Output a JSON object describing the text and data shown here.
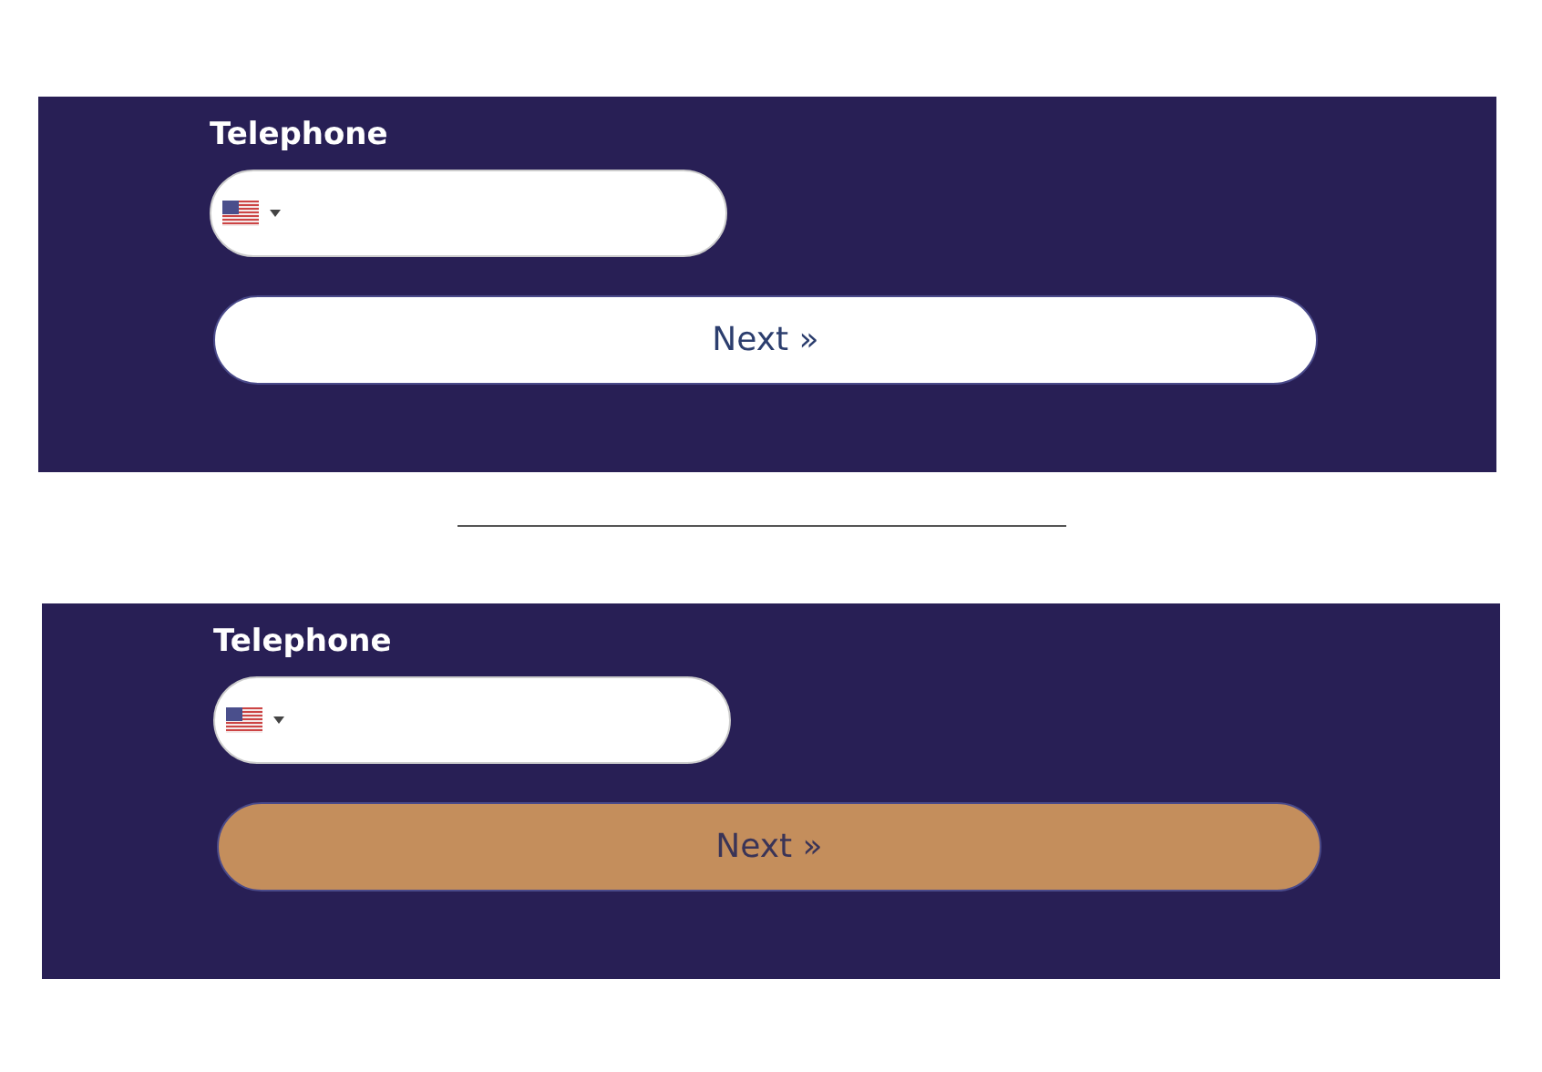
{
  "forms": [
    {
      "label": "Telephone",
      "button": {
        "label": "Next »",
        "hovered": false
      }
    },
    {
      "label": "Telephone",
      "button": {
        "label": "Next »",
        "hovered": true
      }
    }
  ]
}
